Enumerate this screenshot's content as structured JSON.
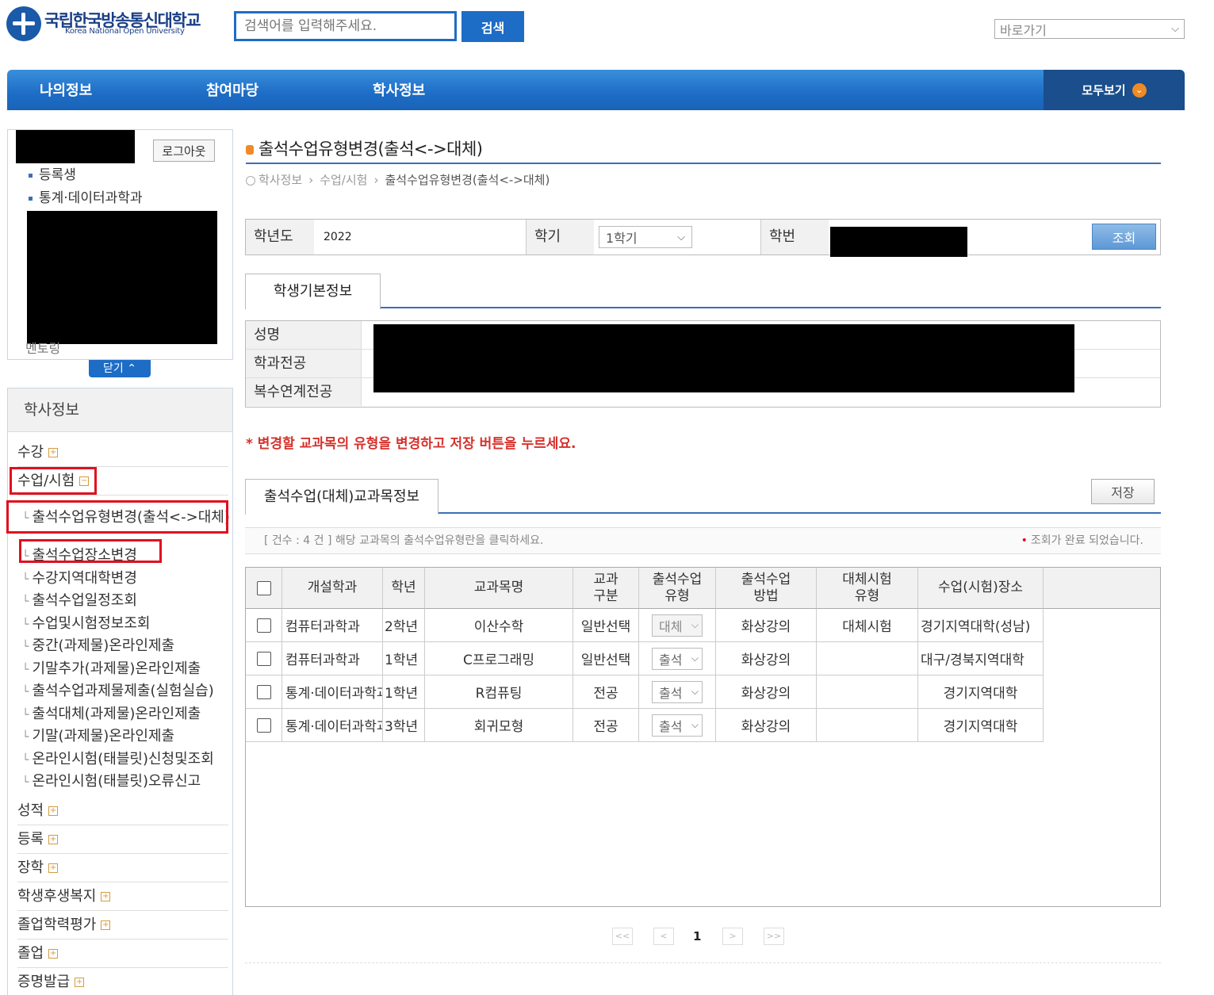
{
  "header": {
    "logo_kr": "국립한국방송통신대학교",
    "logo_en": "Korea National Open University",
    "search_placeholder": "검색어를 입력해주세요.",
    "search_button": "검색",
    "shortcut": "바로가기"
  },
  "nav": {
    "items": [
      "나의정보",
      "참여마당",
      "학사정보"
    ],
    "all": "모두보기"
  },
  "profile": {
    "logout": "로그아웃",
    "status": "등록생",
    "dept": "통계·데이터과학과",
    "tail": "멘토링",
    "close": "닫기"
  },
  "menu": {
    "title": "학사정보",
    "items_top": [
      "수강",
      "수업/시험"
    ],
    "sub": [
      "출석수업유형변경(출석<->대체)",
      "출석수업장소변경",
      "수강지역대학변경",
      "출석수업일정조회",
      "수업및시험정보조회",
      "중간(과제물)온라인제출",
      "기말추가(과제물)온라인제출",
      "출석수업과제물제출(실험실습)",
      "출석대체(과제물)온라인제출",
      "기말(과제물)온라인제출",
      "온라인시험(태블릿)신청및조회",
      "온라인시험(태블릿)오류신고"
    ],
    "items_bottom": [
      "성적",
      "등록",
      "장학",
      "학생후생복지",
      "졸업학력평가",
      "졸업",
      "증명발급"
    ]
  },
  "page": {
    "title": "출석수업유형변경(출석<->대체)",
    "breadcrumb": [
      "학사정보",
      "수업/시험",
      "출석수업유형변경(출석<->대체)"
    ]
  },
  "filter": {
    "year_label": "학년도",
    "year": "2022",
    "semester_label": "학기",
    "semester": "1학기",
    "student_no_label": "학번",
    "query": "조회"
  },
  "basic": {
    "tab": "학생기본정보",
    "labels": [
      "성명",
      "학과전공",
      "복수연계전공"
    ]
  },
  "notice": "* 변경할 교과목의 유형을 변경하고 저장 버튼을 누르세요.",
  "course": {
    "tab": "출석수업(대체)교과목정보",
    "save": "저장",
    "count_text": "[ 건수 : 4 건 ] 해당 교과목의 출석수업유형란을 클릭하세요.",
    "status_text": "조회가 완료 되었습니다.",
    "headers": [
      "개설학과",
      "학년",
      "교과목명",
      "교과\n구분",
      "출석수업\n유형",
      "출석수업\n방법",
      "대체시험\n유형",
      "수업(시험)장소"
    ],
    "rows": [
      {
        "dept": "컴퓨터과학과",
        "year": "2학년",
        "name": "이산수학",
        "category": "일반선택",
        "type": "대체",
        "method": "화상강의",
        "alt": "대체시험",
        "place": "경기지역대학(성남)"
      },
      {
        "dept": "컴퓨터과학과",
        "year": "1학년",
        "name": "C프로그래밍",
        "category": "일반선택",
        "type": "출석",
        "method": "화상강의",
        "alt": "",
        "place": "대구/경북지역대학"
      },
      {
        "dept": "통계·데이터과학과",
        "year": "1학년",
        "name": "R컴퓨팅",
        "category": "전공",
        "type": "출석",
        "method": "화상강의",
        "alt": "",
        "place": "경기지역대학"
      },
      {
        "dept": "통계·데이터과학과",
        "year": "3학년",
        "name": "회귀모형",
        "category": "전공",
        "type": "출석",
        "method": "화상강의",
        "alt": "",
        "place": "경기지역대학"
      }
    ]
  },
  "pager": {
    "first": "<<",
    "prev": "<",
    "page": "1",
    "next": ">",
    "last": ">>"
  }
}
